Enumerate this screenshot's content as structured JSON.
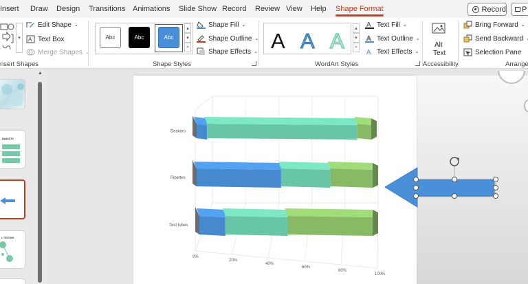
{
  "tabs": [
    {
      "label": "Insert"
    },
    {
      "label": "Draw"
    },
    {
      "label": "Design"
    },
    {
      "label": "Transitions"
    },
    {
      "label": "Animations"
    },
    {
      "label": "Slide Show"
    },
    {
      "label": "Record"
    },
    {
      "label": "Review"
    },
    {
      "label": "View"
    },
    {
      "label": "Help"
    },
    {
      "label": "Shape Format"
    }
  ],
  "record_button": "Record",
  "present_button": "P",
  "ribbon": {
    "insert_shapes": {
      "edit_shape": "Edit Shape",
      "text_box": "Text Box",
      "merge_shapes": "Merge Shapes",
      "label": "nsert Shapes"
    },
    "shape_styles": {
      "boxes": [
        "Abc",
        "Abc",
        "Abc"
      ],
      "fill": "Shape Fill",
      "outline": "Shape Outline",
      "effects": "Shape Effects",
      "label": "Shape Styles"
    },
    "wordart": {
      "letters": [
        "A",
        "A",
        "A"
      ],
      "text_fill": "Text Fill",
      "text_outline": "Text Outline",
      "text_effects": "Text Effects",
      "label": "WordArt Styles"
    },
    "accessibility": {
      "alt_line1": "Alt",
      "alt_line2": "Text",
      "label": "Accessibility"
    },
    "arrange": {
      "bring_forward": "Bring Forward",
      "send_backward": "Send Backward",
      "selection_pane": "Selection Pane",
      "label": "Arrange"
    }
  },
  "thumbnails": {
    "slide2_title": "BASKETS",
    "slide4_title": "L TESTING"
  },
  "colors": {
    "accent": "#c43e1c",
    "blue": "#4a90d9",
    "teal": "#6fcfb0",
    "green": "#8fc46a",
    "selection_blue": "#4f8fd8"
  },
  "chart_data": {
    "type": "bar",
    "orientation": "horizontal-3d-stacked-100",
    "categories": [
      "Beakers",
      "Pipettes",
      "Test tubes"
    ],
    "series": [
      {
        "color": "#4a90d9",
        "values": [
          6,
          48,
          15
        ]
      },
      {
        "color": "#6fcfb0",
        "values": [
          86,
          28,
          36
        ]
      },
      {
        "color": "#8fc46a",
        "values": [
          8,
          24,
          49
        ]
      }
    ],
    "xaxis_ticks": [
      "0%",
      "20%",
      "40%",
      "60%",
      "80%",
      "100%"
    ],
    "xlim": [
      0,
      100
    ]
  }
}
